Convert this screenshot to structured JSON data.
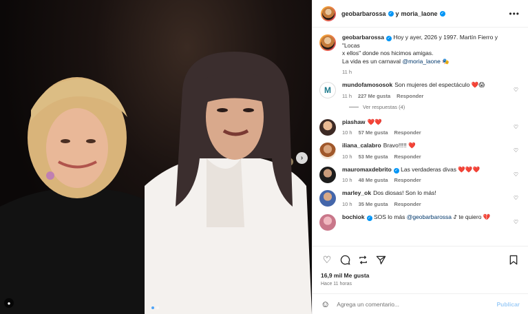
{
  "post": {
    "author": "geobarbarossa",
    "collab_joiner": "y",
    "collaborator": "moria_laone",
    "caption_line1": "Hoy y ayer, 2026 y 1997. Martín Fierro y \"Locas",
    "caption_line2": "x ellos\" donde nos hicimos amigas.",
    "caption_line3": "La vida es un carnaval",
    "caption_mention": "@moria_laone",
    "caption_emoji": "🎭",
    "time": "11 h",
    "likes": "16,9 mil Me gusta",
    "posted_ago": "Hace 11 horas"
  },
  "comments": [
    {
      "user": "mundofamososok",
      "text": "Son mujeres del espectáculo",
      "emoji": "❤️😱",
      "time": "11 h",
      "likes": "227 Me gusta",
      "reply": "Responder",
      "view_replies": "Ver respuestas (4)"
    },
    {
      "user": "piashaw",
      "text": "",
      "emoji": "❤️❤️",
      "time": "10 h",
      "likes": "57 Me gusta",
      "reply": "Responder"
    },
    {
      "user": "iliana_calabro",
      "text": "Bravo!!!!!",
      "emoji": "❤️",
      "time": "10 h",
      "likes": "53 Me gusta",
      "reply": "Responder"
    },
    {
      "user": "mauromaxdebrito",
      "text": "Las verdaderas divas",
      "emoji": "❤️❤️❤️",
      "time": "10 h",
      "likes": "48 Me gusta",
      "reply": "Responder"
    },
    {
      "user": "marley_ok",
      "text": "Dos diosas! Son lo más!",
      "emoji": "",
      "time": "10 h",
      "likes": "35 Me gusta",
      "reply": "Responder"
    },
    {
      "user": "bochiok",
      "text": "SOS lo más",
      "mention": "@geobarbarossa",
      "tail": "𐰀 te quiero",
      "emoji": "💔"
    }
  ],
  "composer": {
    "placeholder": "Agrega un comentario...",
    "publish": "Publicar"
  },
  "icons": {
    "like": "heart-icon",
    "comment": "comment-icon",
    "share": "repost-icon",
    "send": "send-icon",
    "save": "bookmark-icon",
    "more": "more-icon",
    "emoji": "emoji-icon"
  },
  "colors": {
    "verified": "#0095f6",
    "link": "#00376b",
    "publish_disabled": "#9fcdf7",
    "muted": "#737373"
  }
}
